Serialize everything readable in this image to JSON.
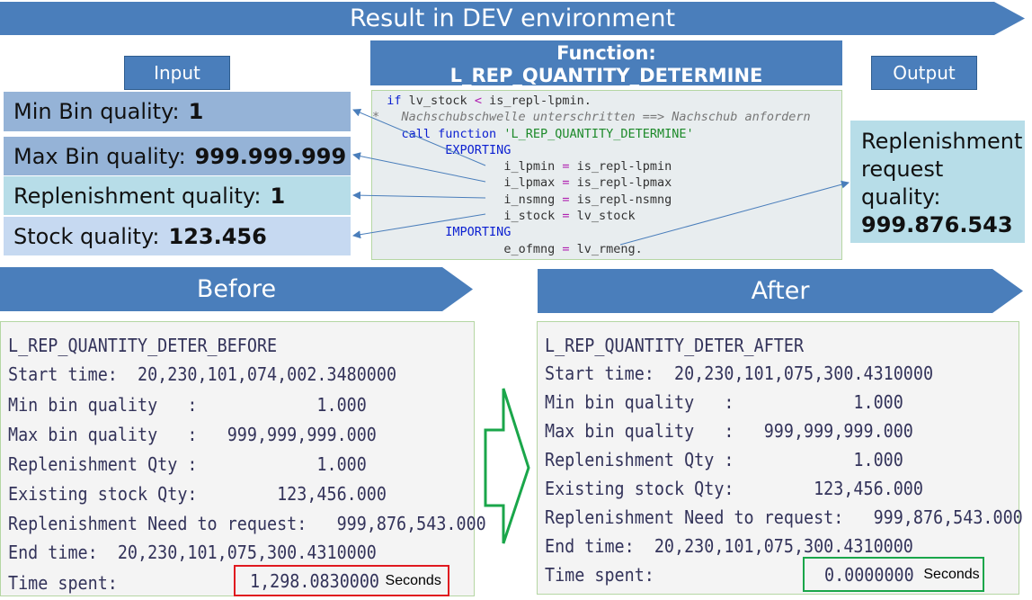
{
  "header": {
    "title": "Result in DEV environment"
  },
  "input": {
    "label": "Input",
    "params": [
      {
        "label": "Min Bin quality:",
        "value": "1"
      },
      {
        "label": "Max Bin quality:",
        "value": "999.999.999"
      },
      {
        "label": "Replenishment quality:",
        "value": "1"
      },
      {
        "label": "Stock quality:",
        "value": "123.456"
      }
    ]
  },
  "function": {
    "title_line1": "Function:",
    "title_line2": "L_REP_QUANTITY_DETERMINE"
  },
  "output": {
    "label": "Output",
    "line1": "Replenishment",
    "line2": "request",
    "line3": "quality:",
    "value": "999.876.543"
  },
  "code": {
    "l1_kw": "if",
    "l1_rest": " lv_stock ",
    "l1_op": "<",
    "l1_end": " is_repl-lpmin.",
    "l2_comment": "*   Nachschubschwelle unterschritten ==> Nachschub anfordern",
    "l3_kw": "call function",
    "l3_str": "'L_REP_QUANTITY_DETERMINE'",
    "l4_kw": "EXPORTING",
    "l5_a": "i_lpmin",
    "l5_b": "is_repl-lpmin",
    "l6_a": "i_lpmax",
    "l6_b": "is_repl-lpmax",
    "l7_a": "i_nsmng",
    "l7_b": "is_repl-nsmng",
    "l8_a": "i_stock",
    "l8_b": "lv_stock",
    "l9_kw": "IMPORTING",
    "l10_a": "e_ofmng",
    "l10_b": "lv_rmeng.",
    "eq": "="
  },
  "before": {
    "title": "Before",
    "lines": [
      "L_REP_QUANTITY_DETER_BEFORE",
      "Start time:  20,230,101,074,002.3480000",
      "Min bin quality   :            1.000",
      "Max bin quality   :   999,999,999.000",
      "Replenishment Qty :            1.000",
      "Existing stock Qty:        123,456.000",
      "Replenishment Need to request:   999,876,543.000",
      "End time:  20,230,101,075,300.4310000",
      "Time spent:"
    ],
    "time_value": "1,298.0830000",
    "time_unit": "Seconds"
  },
  "after": {
    "title": "After",
    "lines": [
      "L_REP_QUANTITY_DETER_AFTER",
      "Start time:  20,230,101,075,300.4310000",
      "Min bin quality   :            1.000",
      "Max bin quality   :   999,999,999.000",
      "Replenishment Qty :            1.000",
      "Existing stock Qty:        123,456.000",
      "Replenishment Need to request:   999,876,543.000",
      "End time:  20,230,101,075,300.4310000",
      "Time spent:"
    ],
    "time_value": "0.0000000",
    "time_unit": "Seconds"
  },
  "colors": {
    "banner": "#4a7ebb",
    "before_highlight": "#e0191f",
    "after_highlight": "#1aa64a",
    "transition_arrow": "#1aa64a"
  }
}
